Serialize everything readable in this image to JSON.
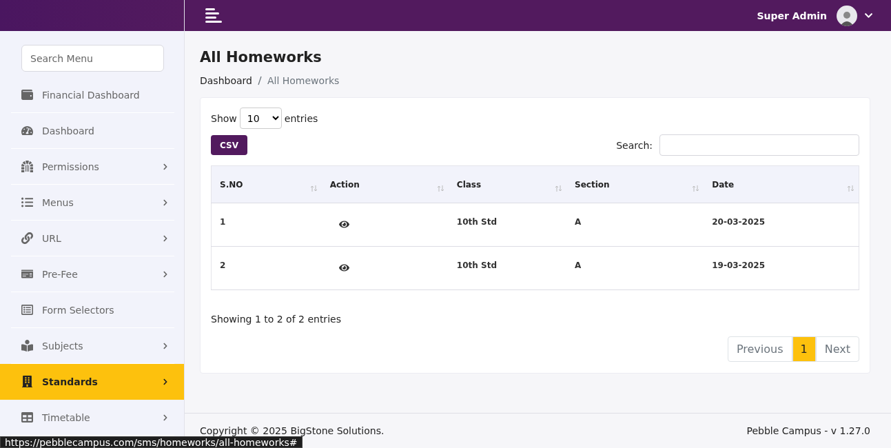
{
  "sidebar": {
    "search": {
      "placeholder": "Search Menu"
    },
    "items": [
      {
        "label": "Financial Dashboard",
        "has_submenu": false,
        "selected": false
      },
      {
        "label": "Dashboard",
        "has_submenu": false,
        "selected": false
      },
      {
        "label": "Permissions",
        "has_submenu": true,
        "selected": false
      },
      {
        "label": "Menus",
        "has_submenu": true,
        "selected": false
      },
      {
        "label": "URL",
        "has_submenu": true,
        "selected": false
      },
      {
        "label": "Pre-Fee",
        "has_submenu": true,
        "selected": false
      },
      {
        "label": "Form Selectors",
        "has_submenu": false,
        "selected": false
      },
      {
        "label": "Subjects",
        "has_submenu": true,
        "selected": false
      },
      {
        "label": "Standards",
        "has_submenu": true,
        "selected": true
      },
      {
        "label": "Timetable",
        "has_submenu": true,
        "selected": false
      }
    ]
  },
  "topbar": {
    "user": "Super Admin"
  },
  "page": {
    "title": "All Homeworks",
    "breadcrumb": [
      {
        "label": "Dashboard",
        "current": false
      },
      {
        "label": "All Homeworks",
        "current": true
      }
    ]
  },
  "table_controls": {
    "show_label": "Show",
    "page_size": "10",
    "entries_label": "entries",
    "csv_button": "CSV",
    "search_label": "Search:"
  },
  "table": {
    "columns": [
      "S.NO",
      "Action",
      "Class",
      "Section",
      "Date"
    ],
    "rows": [
      {
        "sno": "1",
        "class": "10th Std",
        "section": "A",
        "date": "20-03-2025"
      },
      {
        "sno": "2",
        "class": "10th Std",
        "section": "A",
        "date": "19-03-2025"
      }
    ]
  },
  "info": "Showing 1 to 2 of 2 entries",
  "pagination": {
    "previous": "Previous",
    "pages": [
      {
        "label": "1",
        "selected": true
      }
    ],
    "next": "Next"
  },
  "footer": {
    "copyright": "Copyright © 2025 BigStone Solutions.",
    "version": "Pebble Campus - v 1.27.0"
  },
  "status_bar": {
    "url": "https://pebblecampus.com/sms/homeworks/all-homeworks#"
  }
}
